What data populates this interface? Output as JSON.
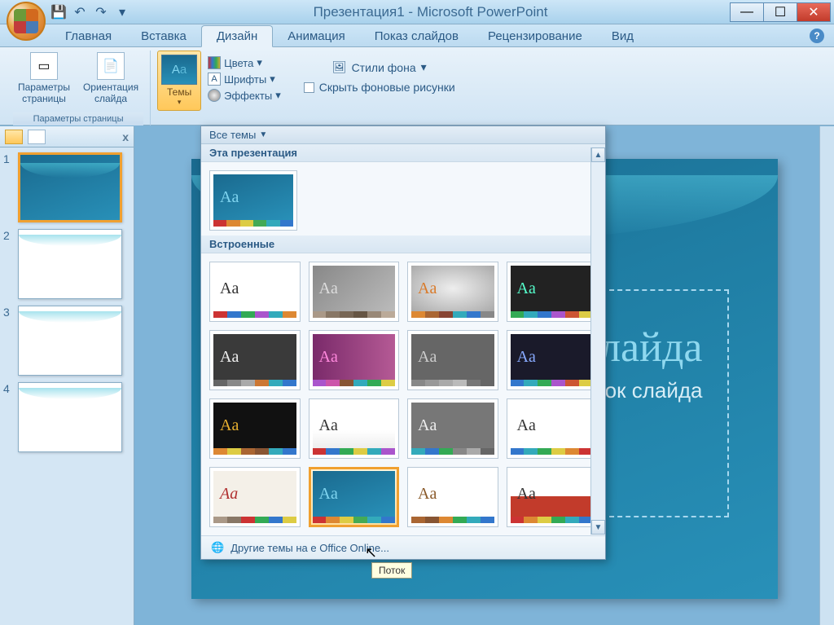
{
  "title": "Презентация1 - Microsoft PowerPoint",
  "tabs": {
    "home": "Главная",
    "insert": "Вставка",
    "design": "Дизайн",
    "animation": "Анимация",
    "slideshow": "Показ слайдов",
    "review": "Рецензирование",
    "view": "Вид"
  },
  "ribbon": {
    "page_params": "Параметры\nстраницы",
    "orientation": "Ориентация\nслайда",
    "group_pagesetup": "Параметры страницы",
    "themes": "Темы",
    "colors": "Цвета",
    "fonts": "Шрифты",
    "effects": "Эффекты",
    "bg_styles": "Стили фона",
    "hide_bg": "Скрыть фоновые рисунки"
  },
  "gallery": {
    "all_themes": "Все темы",
    "this_pres": "Эта презентация",
    "builtin": "Встроенные",
    "more_online": "Другие темы на          e Office Online...",
    "tooltip": "Поток"
  },
  "slide": {
    "title_text": "слайда",
    "subtitle_text": "ловок слайда"
  },
  "thumbs": {
    "n1": "1",
    "n2": "2",
    "n3": "3",
    "n4": "4"
  }
}
